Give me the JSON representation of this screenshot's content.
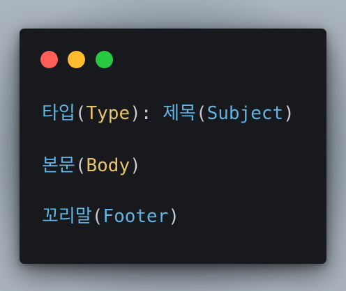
{
  "window": {
    "controls": [
      {
        "name": "close",
        "color": "#ff5f57"
      },
      {
        "name": "minimize",
        "color": "#febc2e"
      },
      {
        "name": "maximize",
        "color": "#28c840"
      }
    ]
  },
  "code": {
    "line1": {
      "label1": "타입",
      "open1": "(",
      "value1": "Type",
      "close1": "):",
      "label2": "제목",
      "open2": "(",
      "value2": "Subject",
      "close2": ")"
    },
    "line2": {
      "label": "본문",
      "open": "(",
      "value": "Body",
      "close": ")"
    },
    "line3": {
      "label": "꼬리말",
      "open": "(",
      "value": "Footer",
      "close": ")"
    }
  },
  "colors": {
    "background": "#17191c",
    "keyword": "#61b4e4",
    "value_yellow": "#e8c56b",
    "punctuation": "#c8ccd2"
  }
}
